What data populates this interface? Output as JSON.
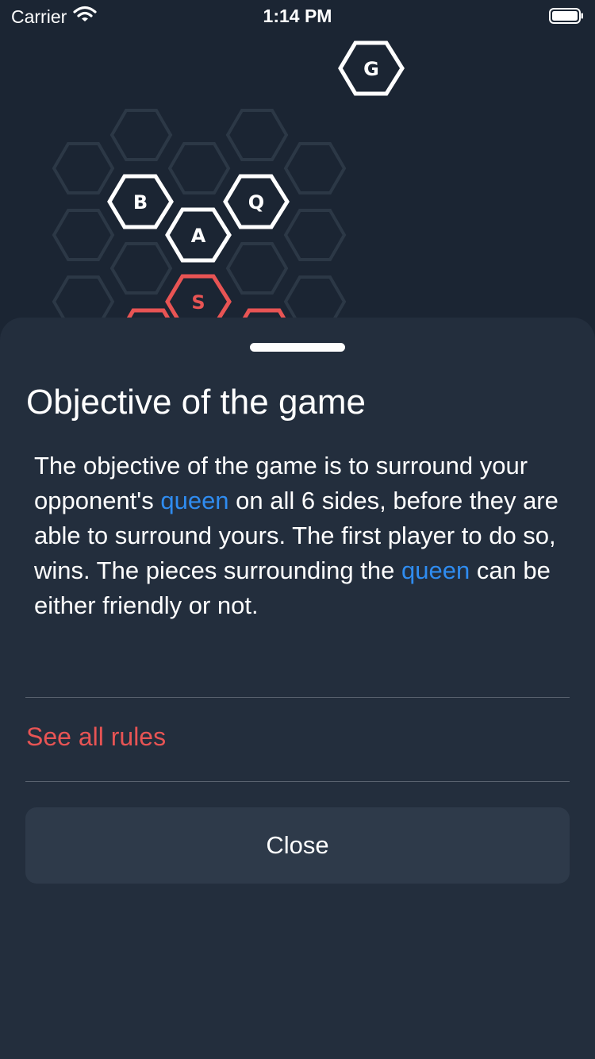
{
  "status_bar": {
    "carrier": "Carrier",
    "time": "1:14 PM",
    "wifi_icon": "wifi-icon",
    "battery_icon": "battery-icon"
  },
  "board": {
    "tiles": [
      {
        "letter": "G",
        "color": "#ffffff"
      },
      {
        "letter": "B",
        "color": "#ffffff"
      },
      {
        "letter": "Q",
        "color": "#ffffff"
      },
      {
        "letter": "A",
        "color": "#ffffff"
      },
      {
        "letter": "S",
        "color": "#e85454"
      }
    ]
  },
  "sheet": {
    "title": "Objective of the game",
    "body": {
      "part1": "The objective of the game is to surround your opponent's ",
      "highlight1": "queen",
      "part2": " on all 6 sides, before they are able to surround yours. The first player to do so, wins. The pieces surrounding the ",
      "highlight2": "queen",
      "part3": " can be either friendly or not."
    },
    "rules_link": "See all rules",
    "close_button": "Close"
  },
  "colors": {
    "background": "#1b2533",
    "sheet": "#232e3d",
    "accent_link": "#e85454",
    "highlight": "#2f8cf0",
    "button": "#2e3a4a"
  }
}
